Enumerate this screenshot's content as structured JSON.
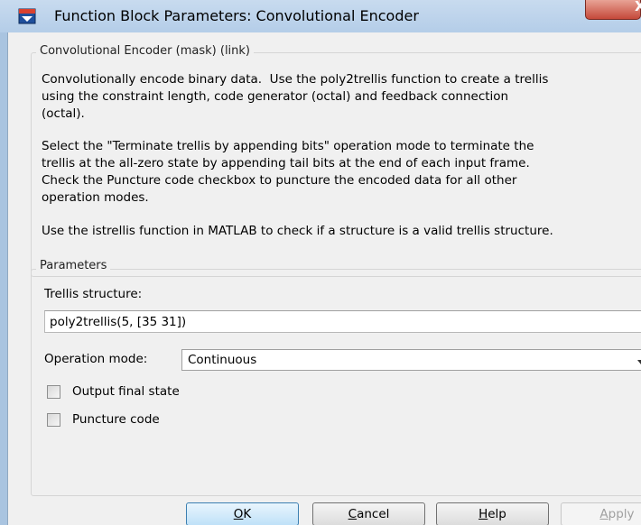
{
  "window": {
    "title": "Function Block Parameters: Convolutional Encoder",
    "close_glyph": "X"
  },
  "description": {
    "heading": "Convolutional Encoder (mask) (link)",
    "p1": "Convolutionally encode binary data.  Use the poly2trellis function to create a trellis\nusing the constraint length, code generator (octal) and feedback connection\n(octal).",
    "p2": "Select the \"Terminate trellis by appending bits\" operation mode to terminate the\ntrellis at the all-zero state by appending tail bits at the end of each input frame.\nCheck the Puncture code checkbox to puncture the encoded data for all other\noperation modes.",
    "p3": "Use the istrellis function in MATLAB to check if a structure is a valid trellis structure."
  },
  "parameters": {
    "heading": "Parameters",
    "trellis_label": "Trellis structure:",
    "trellis_value": "poly2trellis(5, [35 31])",
    "mode_label": "Operation mode:",
    "mode_value": "Continuous",
    "output_final_state_label": "Output final state",
    "output_final_state_checked": false,
    "puncture_code_label": "Puncture code",
    "puncture_code_checked": false
  },
  "buttons": {
    "ok": {
      "mnemonic": "O",
      "rest": "K"
    },
    "cancel": {
      "mnemonic": "C",
      "rest": "ancel"
    },
    "help": {
      "mnemonic": "H",
      "rest": "elp"
    },
    "apply": {
      "mnemonic": "A",
      "rest": "pply",
      "enabled": false
    }
  },
  "icons": {
    "app": "simulink-block-icon",
    "close": "close-icon",
    "dropdown": "chevron-down-icon"
  }
}
